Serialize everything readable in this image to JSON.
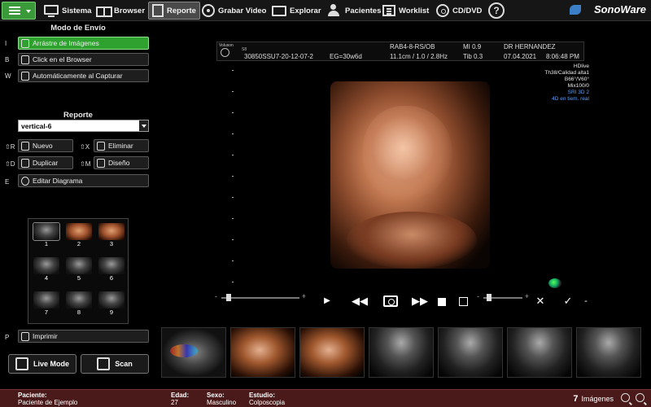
{
  "toolbar": {
    "items": [
      {
        "label": "Sistema",
        "icon": "monitor-icon"
      },
      {
        "label": "Browser",
        "icon": "grid-icon"
      },
      {
        "label": "Reporte",
        "icon": "document-icon",
        "active": true
      },
      {
        "label": "Grabar Video",
        "icon": "record-icon"
      },
      {
        "label": "Explorar",
        "icon": "folder-icon"
      },
      {
        "label": "Pacientes",
        "icon": "patients-icon"
      },
      {
        "label": "Worklist",
        "icon": "worklist-icon"
      },
      {
        "label": "CD/DVD",
        "icon": "disc-icon"
      }
    ],
    "help": "?",
    "logo": "SonoWare",
    "accent": "#2ea12e"
  },
  "send_mode": {
    "title": "Modo de Envío",
    "options": [
      {
        "key": "I",
        "label": "Arrástre de Imágenes",
        "selected": true
      },
      {
        "key": "B",
        "label": "Click en el Browser",
        "selected": false
      },
      {
        "key": "W",
        "label": "Automáticamente al Capturar",
        "selected": false
      }
    ]
  },
  "report": {
    "title": "Reporte",
    "select_value": "vertical-6",
    "buttons": [
      {
        "key": "⇧R",
        "label": "Nuevo"
      },
      {
        "key": "⇧X",
        "label": "Eliminar"
      },
      {
        "key": "⇧D",
        "label": "Duplicar"
      },
      {
        "key": "⇧M",
        "label": "Diseño"
      }
    ],
    "edit_key": "E",
    "edit_label": "Editar Diagrama"
  },
  "thumbs": [
    "1",
    "2",
    "3",
    "4",
    "5",
    "6",
    "7",
    "8",
    "9"
  ],
  "print": {
    "key": "P",
    "label": "Imprimir"
  },
  "live_mode": "Live Mode",
  "scan": "Scan",
  "viewer": {
    "brand_small": "Voluson",
    "probe": "S8",
    "program": "RAB4-8-RS/OB",
    "mi": "MI  0.9",
    "doctor": "DR HERNANDEZ",
    "patient_id": "30850SSU7-20-12-07-2",
    "eg": "EG=30w6d",
    "depth": "11.1cm / 1.0 / 2.8Hz",
    "tib": "Tib  0.3",
    "date": "07.04.2021",
    "time": "8:06:48 PM",
    "params": [
      "HDlive",
      "Th38/Calidad alta1",
      "B66°/V60°",
      "Mix100/0"
    ],
    "params_blue": [
      "SRI 3D 2",
      "4D en tiem. real"
    ]
  },
  "controls": {
    "slider_minus": "-",
    "slider_plus": "+"
  },
  "filmstrip": [
    "color",
    "face",
    "face",
    "gray",
    "gray",
    "gray",
    "gray"
  ],
  "status": {
    "patient_label": "Paciente:",
    "patient_value": "Paciente de Ejemplo",
    "age_label": "Edad:",
    "age_value": "27",
    "sex_label": "Sexo:",
    "sex_value": "Masculino",
    "study_label": "Estudio:",
    "study_value": "Colposcopia",
    "image_count": "7",
    "image_label": "Imágenes",
    "bar_color": "#4a1a1a"
  }
}
